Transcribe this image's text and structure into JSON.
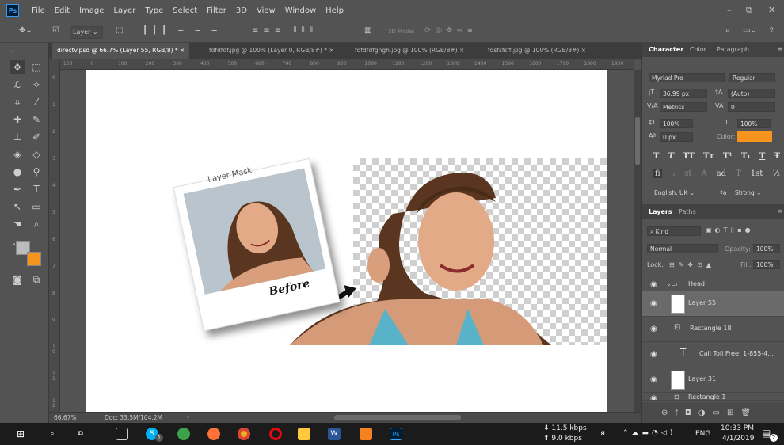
{
  "app": {
    "logo": "Ps"
  },
  "menu": [
    "File",
    "Edit",
    "Image",
    "Layer",
    "Type",
    "Select",
    "Filter",
    "3D",
    "View",
    "Window",
    "Help"
  ],
  "window_controls": {
    "minimize": "–",
    "restore": "⧉",
    "close": "✕"
  },
  "options_bar": {
    "layer_dropdown": "Layer",
    "mode3d": "3D Mode:"
  },
  "doc_tabs": [
    {
      "label": "directv.psd @ 66.7% (Layer 55, RGB/8) *",
      "close": "×",
      "active": true
    },
    {
      "label": "fdfdfdf.jpg @ 100% (Layer 0, RGB/8#) *",
      "close": "×",
      "active": false
    },
    {
      "label": "fdfdfdfghgh.jpg @ 100% (RGB/8#)",
      "close": "×",
      "active": false
    },
    {
      "label": "fdsfsfsff.jpg @ 100% (RGB/8#)",
      "close": "×",
      "active": false
    }
  ],
  "ruler_h": [
    "100",
    "0",
    "100",
    "200",
    "300",
    "400",
    "500",
    "600",
    "700",
    "800",
    "900",
    "1000",
    "1100",
    "1200",
    "1300",
    "1400",
    "1500",
    "1600",
    "1700",
    "1800",
    "1900"
  ],
  "ruler_v": [
    "0",
    "1",
    "2",
    "3",
    "4",
    "5",
    "6",
    "7",
    "8",
    "9",
    "1 0",
    "1 1",
    "1 2"
  ],
  "canvas": {
    "polaroid_caption": "Layer Mask",
    "before_label": "Before"
  },
  "status": {
    "zoom": "66.67%",
    "doc": "Doc: 33.5M/104.2M",
    "arrow": "›"
  },
  "character_panel": {
    "tabs": [
      "Character",
      "Color",
      "Paragraph"
    ],
    "font_family": "Myriad Pro",
    "font_style": "Regular",
    "font_size": "36.99 px",
    "leading": "(Auto)",
    "kerning": "Metrics",
    "tracking": "0",
    "vscale": "100%",
    "hscale": "100%",
    "baseline": "0 px",
    "color_label": "Color:",
    "color_swatch": "#f7941d",
    "type_styles": [
      "T",
      "T",
      "TT",
      "Tт",
      "T¹",
      "T₁",
      "T",
      "Ŧ"
    ],
    "opentype": [
      "fi",
      "ℴ",
      "st",
      "A",
      "ad",
      "T",
      "1st",
      "½"
    ],
    "language": "English: UK",
    "aa_icon": "ªa",
    "aa": "Strong"
  },
  "layers_panel": {
    "tabs": [
      "Layers",
      "Paths"
    ],
    "kind": "Kind",
    "blend": "Normal",
    "opacity_label": "Opacity:",
    "opacity": "100%",
    "lock_label": "Lock:",
    "fill_label": "Fill:",
    "fill": "100%",
    "layers": [
      {
        "name": "Head",
        "type": "group",
        "selected": false
      },
      {
        "name": "Layer 55",
        "type": "pixel",
        "selected": true
      },
      {
        "name": "Rectangle 18",
        "type": "shape",
        "selected": false
      },
      {
        "name": "Call Toll Free: 1-855-4...",
        "type": "text",
        "selected": false
      },
      {
        "name": "Layer 31",
        "type": "pixel",
        "selected": false
      },
      {
        "name": "Rectangle 1",
        "type": "shape",
        "selected": false
      }
    ]
  },
  "taskbar": {
    "net_down": "11.5 kbps",
    "net_up": "9.0 kbps",
    "lang": "ENG",
    "time": "10:33 PM",
    "date": "4/1/2019",
    "notif_count": "2",
    "skype_badge": "1"
  },
  "colors": {
    "accent": "#f7941d",
    "ui_bg": "#535353",
    "ps_blue": "#31a8ff"
  }
}
